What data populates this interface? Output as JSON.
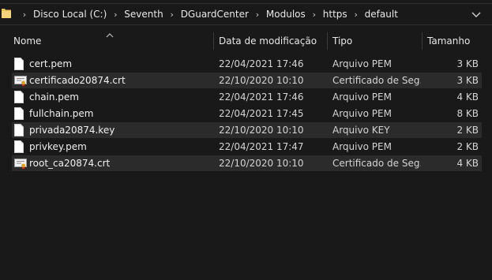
{
  "address_bar": {
    "crumbs": [
      "Disco Local (C:)",
      "Seventh",
      "DGuardCenter",
      "Modulos",
      "https",
      "default"
    ]
  },
  "columns": {
    "name": "Nome",
    "date": "Data de modificação",
    "type": "Tipo",
    "size": "Tamanho"
  },
  "files": [
    {
      "name": "cert.pem",
      "date": "22/04/2021 17:46",
      "type": "Arquivo PEM",
      "size": "3 KB",
      "icon": "document-icon"
    },
    {
      "name": "certificado20874.crt",
      "date": "22/10/2020 10:10",
      "type": "Certificado de Seg...",
      "size": "3 KB",
      "icon": "certificate-icon"
    },
    {
      "name": "chain.pem",
      "date": "22/04/2021 17:46",
      "type": "Arquivo PEM",
      "size": "4 KB",
      "icon": "document-icon"
    },
    {
      "name": "fullchain.pem",
      "date": "22/04/2021 17:45",
      "type": "Arquivo PEM",
      "size": "8 KB",
      "icon": "document-icon"
    },
    {
      "name": "privada20874.key",
      "date": "22/10/2020 10:10",
      "type": "Arquivo KEY",
      "size": "2 KB",
      "icon": "document-icon"
    },
    {
      "name": "privkey.pem",
      "date": "22/04/2021 17:47",
      "type": "Arquivo PEM",
      "size": "2 KB",
      "icon": "document-icon"
    },
    {
      "name": "root_ca20874.crt",
      "date": "22/10/2020 10:10",
      "type": "Certificado de Seg...",
      "size": "4 KB",
      "icon": "certificate-icon"
    }
  ]
}
